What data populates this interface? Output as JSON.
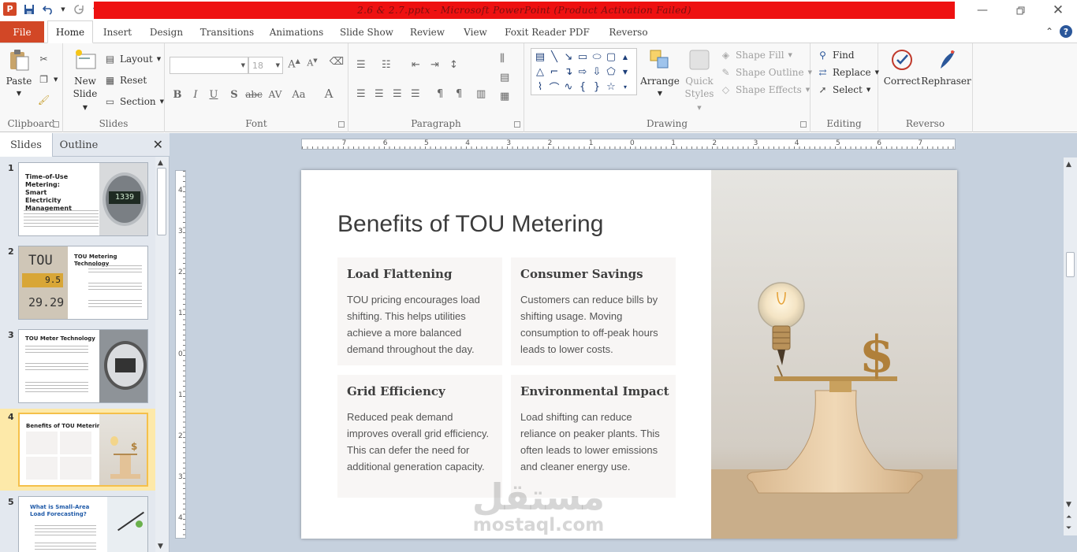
{
  "window": {
    "title": "2.6  & 2.7.pptx  -  Microsoft PowerPoint (Product Activation Failed)"
  },
  "ribbon_tabs": [
    "File",
    "Home",
    "Insert",
    "Design",
    "Transitions",
    "Animations",
    "Slide Show",
    "Review",
    "View",
    "Foxit Reader PDF",
    "Reverso"
  ],
  "active_tab": "Home",
  "groups": {
    "clipboard": {
      "label": "Clipboard",
      "paste": "Paste"
    },
    "slides": {
      "label": "Slides",
      "new_slide": "New",
      "new_slide2": "Slide",
      "layout": "Layout",
      "reset": "Reset",
      "section": "Section"
    },
    "font": {
      "label": "Font",
      "size": "18",
      "bold": "B",
      "italic": "I",
      "underline": "U",
      "shadow": "S",
      "strike": "abc",
      "spacing": "AV",
      "case": "Aa",
      "color": "A"
    },
    "paragraph": {
      "label": "Paragraph"
    },
    "drawing": {
      "label": "Drawing",
      "arrange": "Arrange",
      "quick_styles": "Quick",
      "quick_styles2": "Styles",
      "shape_fill": "Shape Fill",
      "shape_outline": "Shape Outline",
      "shape_effects": "Shape Effects"
    },
    "editing": {
      "label": "Editing",
      "find": "Find",
      "replace": "Replace",
      "select": "Select"
    },
    "reverso": {
      "label": "Reverso",
      "correct": "Correct",
      "rephraser": "Rephraser"
    }
  },
  "pane": {
    "tab_slides": "Slides",
    "tab_outline": "Outline"
  },
  "thumbnails": [
    {
      "num": "1",
      "title": "Time-of-Use Metering: Smart Electricity Management",
      "meter": "1339"
    },
    {
      "num": "2",
      "title": "TOU Metering Technology",
      "meter_a": "TOU",
      "meter_b": "9.5",
      "meter_c": "29.29"
    },
    {
      "num": "3",
      "title": "TOU Meter Technology"
    },
    {
      "num": "4",
      "title": "Benefits of TOU Metering"
    },
    {
      "num": "5",
      "title": "What is Small-Area Load Forecasting?"
    }
  ],
  "ruler_h": [
    "7",
    "6",
    "5",
    "4",
    "3",
    "2",
    "1",
    "0",
    "1",
    "2",
    "3",
    "4",
    "5",
    "6",
    "7"
  ],
  "ruler_v": [
    "4",
    "3",
    "2",
    "1",
    "0",
    "1",
    "2",
    "3",
    "4"
  ],
  "slide": {
    "title": "Benefits of TOU Metering",
    "cards": [
      {
        "heading": "Load Flattening",
        "body": "TOU pricing encourages load shifting. This helps utilities achieve a more balanced demand throughout the day."
      },
      {
        "heading": "Consumer Savings",
        "body": "Customers can reduce bills by shifting usage. Moving consumption to off-peak hours leads to lower costs."
      },
      {
        "heading": "Grid Efficiency",
        "body": "Reduced peak demand improves overall grid efficiency. This can defer the need for additional generation capacity."
      },
      {
        "heading": "Environmental Impact",
        "body": "Load shifting can reduce reliance on peaker plants. This often leads to lower emissions and cleaner energy use."
      }
    ]
  },
  "watermark": {
    "arabic": "مستقل",
    "latin": "mostaql.com"
  },
  "colors": {
    "file_tab": "#d24726",
    "title_alert": "#ee1111",
    "selection": "#f5c04a"
  }
}
